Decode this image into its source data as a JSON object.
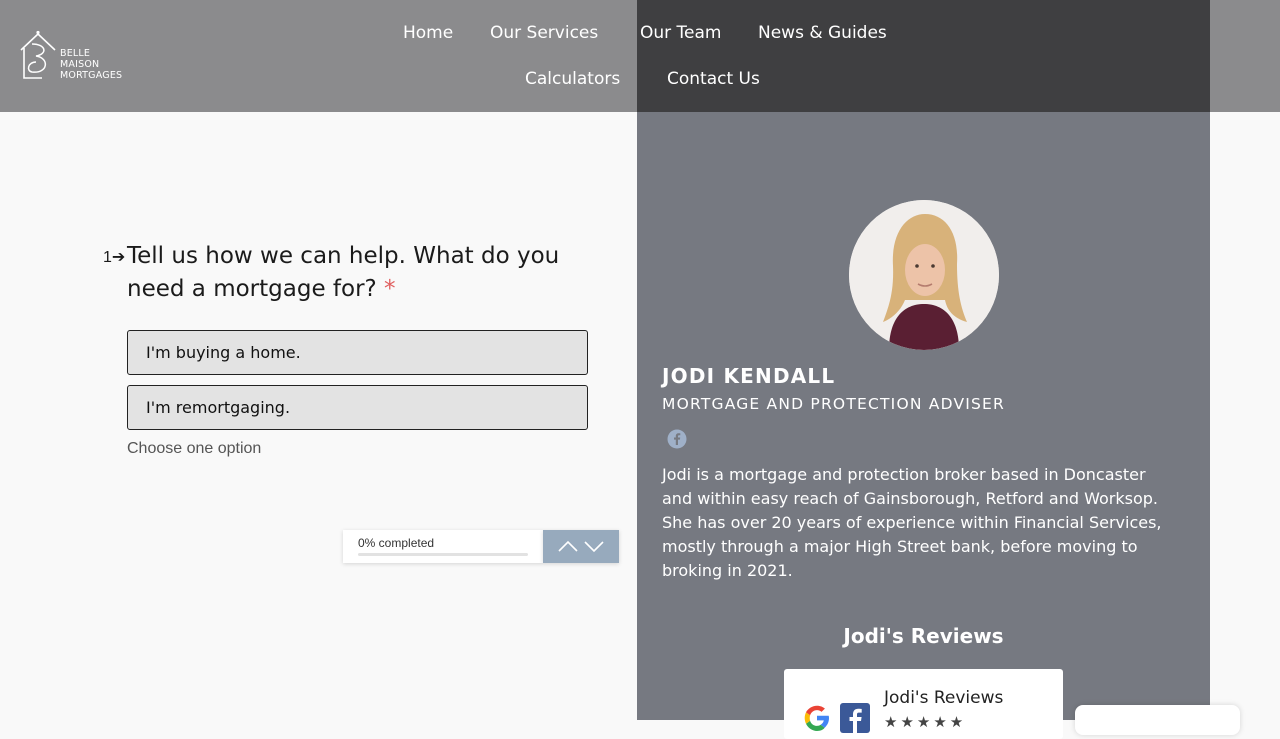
{
  "header": {
    "logo_lines": [
      "BELLE",
      "MAISON",
      "MORTGAGES"
    ],
    "nav": [
      "Home",
      "Our Services",
      "Our Team",
      "News & Guides",
      "Calculators",
      "Contact Us"
    ]
  },
  "form": {
    "question_number": "1",
    "question_text": "Tell us how we can help. What do you need a mortgage for?",
    "required_mark": "*",
    "options": [
      "I'm buying a home.",
      "I'm remortgaging."
    ],
    "hint": "Choose one option",
    "progress_label": "0% completed",
    "progress_percent": 0
  },
  "adviser": {
    "name": "JODI KENDALL",
    "role": "MORTGAGE AND PROTECTION ADVISER",
    "bio": "Jodi is a mortgage and protection broker based in Doncaster and within easy reach of Gainsborough, Retford and Worksop. She has over 20 years of experience within Financial Services, mostly through a major High Street bank, before moving to broking in 2021.",
    "reviews_heading": "Jodi's Reviews",
    "review_card_title": "Jodi's Reviews"
  },
  "colors": {
    "header": "#8b8b8d",
    "header_dark": "#3f3f41",
    "panel": "#767981",
    "option_bg": "#e3e3e3",
    "required": "#e06060",
    "nav_buttons": "#97aabd"
  },
  "icons": [
    "logo-house-icon",
    "facebook-icon",
    "google-logo-icon",
    "facebook-logo-icon",
    "chevron-up-icon",
    "chevron-down-icon"
  ]
}
